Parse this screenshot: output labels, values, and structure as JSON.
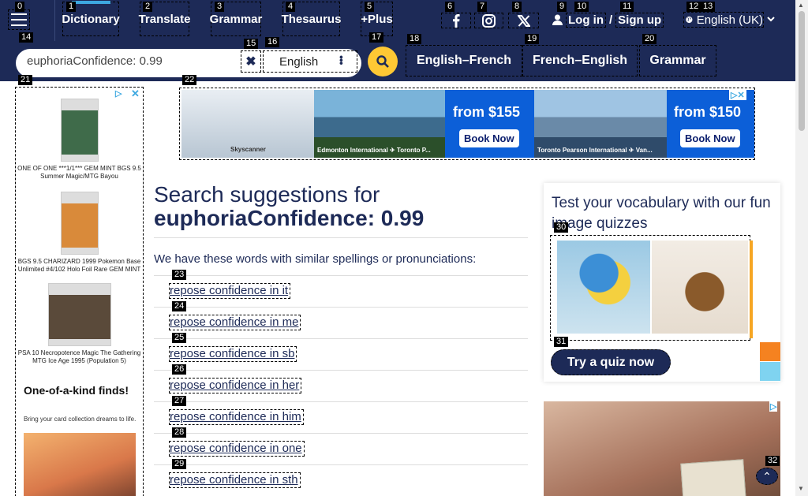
{
  "nav": {
    "items": [
      {
        "label": "Dictionary",
        "active": true
      },
      {
        "label": "Translate",
        "active": false
      },
      {
        "label": "Grammar",
        "active": false
      },
      {
        "label": "Thesaurus",
        "active": false
      },
      {
        "label": "+Plus",
        "active": false
      }
    ],
    "social": [
      "facebook-icon",
      "instagram-icon",
      "x-icon"
    ],
    "login_label": "Log in",
    "slash": "/",
    "signup_label": "Sign up",
    "language_label": "English (UK)"
  },
  "search": {
    "value": "euphoriaConfidence: 0.99",
    "dictionary": "English",
    "quick_links": [
      "English–French",
      "French–English",
      "Grammar"
    ]
  },
  "badges": [
    "0",
    "1",
    "2",
    "3",
    "4",
    "5",
    "6",
    "7",
    "8",
    "9",
    "10",
    "11",
    "12",
    "13",
    "14",
    "15",
    "16",
    "17",
    "18",
    "19",
    "20",
    "21",
    "22",
    "23",
    "24",
    "25",
    "26",
    "27",
    "28",
    "29",
    "30",
    "31",
    "32"
  ],
  "left_ad": {
    "cards": [
      "ONE OF ONE ***1/1*** GEM MINT BGS 9.5 Summer Magic/MTG Bayou",
      "BGS 9.5 CHARIZARD 1999 Pokemon Base Unlimited #4/102 Holo Foil Rare GEM MINT",
      "PSA 10 Necropotence Magic The Gathering MTG Ice Age 1995 (Population 5)"
    ],
    "headline": "One-of-a-kind finds!",
    "subline": "Bring your card collection dreams to life."
  },
  "banner_ad": {
    "offers": [
      {
        "price": "from $155",
        "cta": "Book Now",
        "caption": "Edmonton International ✈ Toronto P..."
      },
      {
        "price": "from $150",
        "cta": "Book Now",
        "caption": "Toronto Pearson International ✈ Van..."
      }
    ],
    "brand": "Skyscanner"
  },
  "main": {
    "title_prefix": "Search suggestions for",
    "query": "euphoriaConfidence: 0.99",
    "intro": "We have these words with similar spellings or pronunciations:",
    "suggestions": [
      "repose confidence in it",
      "repose confidence in me",
      "repose confidence in sb",
      "repose confidence in her",
      "repose confidence in him",
      "repose confidence in one",
      "repose confidence in sth"
    ]
  },
  "quiz": {
    "title": "Test your vocabulary with our fun image quizzes",
    "button": "Try a quiz now"
  },
  "colors": {
    "navy": "#1d2a57",
    "accent_yellow": "#fec834",
    "active_blue": "#3da8e0"
  }
}
